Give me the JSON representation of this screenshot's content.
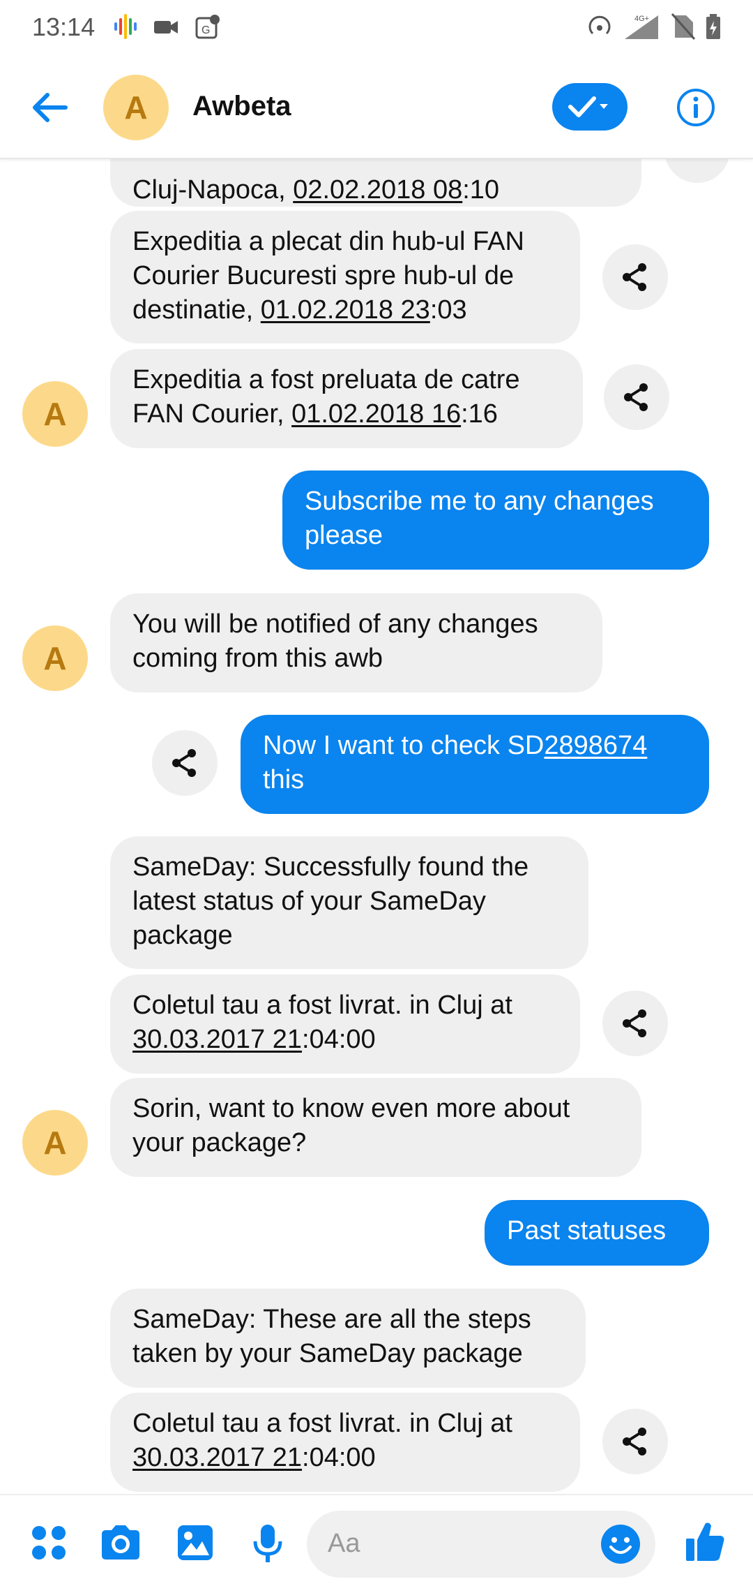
{
  "status_bar": {
    "time": "13:14",
    "network": "4G+"
  },
  "header": {
    "title": "Awbeta",
    "avatar_letter": "A"
  },
  "messages": [
    {
      "dir": "in",
      "parts": [
        "Cluj-Napoca, ",
        "02.02.2018 08",
        ":10"
      ]
    },
    {
      "dir": "in",
      "parts": [
        "Expeditia a plecat din hub-ul FAN Courier Bucuresti spre hub-ul de destinatie, ",
        "01.02.2018 23",
        ":03"
      ]
    },
    {
      "dir": "in",
      "parts": [
        "Expeditia a fost preluata de catre FAN Courier, ",
        "01.02.2018 16",
        ":16"
      ]
    },
    {
      "dir": "out",
      "text": "Subscribe me to any changes please"
    },
    {
      "dir": "in",
      "text": "You will be notified of any changes coming from this awb"
    },
    {
      "dir": "out",
      "parts": [
        "Now I want to check SD",
        "2898674",
        " this"
      ]
    },
    {
      "dir": "in",
      "text": "SameDay: Successfully found the latest status of your SameDay package"
    },
    {
      "dir": "in",
      "parts": [
        "Coletul tau a fost livrat. in  Cluj at ",
        "30.03.2017 21",
        ":04:00"
      ]
    },
    {
      "dir": "in",
      "text": "Sorin, want to know even more about your package?"
    },
    {
      "dir": "out",
      "text": "Past statuses"
    },
    {
      "dir": "in",
      "text": "SameDay: These are all the steps taken by your SameDay package"
    },
    {
      "dir": "in",
      "parts": [
        "Coletul tau a fost livrat. in  Cluj at ",
        "30.03.2017 21",
        ":04:00"
      ]
    }
  ],
  "composer": {
    "placeholder": "Aa"
  },
  "icons": {
    "status": [
      "podcast-icon",
      "video-camera-icon",
      "maps-icon",
      "hotspot-icon",
      "signal-icon",
      "no-sim-icon",
      "battery-icon"
    ],
    "header": [
      "back-arrow-icon",
      "check-dropdown-icon",
      "info-icon"
    ],
    "composer": [
      "apps-icon",
      "camera-icon",
      "image-icon",
      "microphone-icon",
      "emoji-icon",
      "thumbs-up-icon"
    ],
    "message": "share-icon"
  },
  "colors": {
    "accent": "#0a84ee",
    "incoming_bubble": "#efefef",
    "avatar_bg": "#fcd98a",
    "avatar_fg": "#b77a10"
  }
}
